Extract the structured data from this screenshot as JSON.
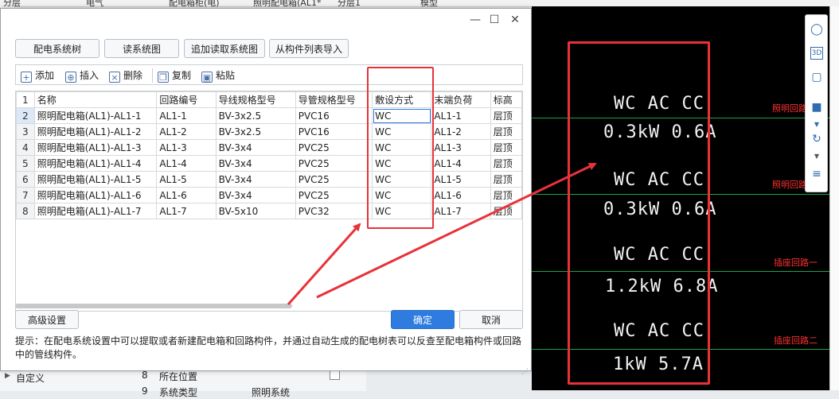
{
  "background": {
    "top_tabs": [
      "分层",
      "电气",
      "配电箱柜(电)",
      "照明配电箱(AL1*",
      "分层1",
      "模型"
    ],
    "left_bottom_label": "自定义",
    "bottom_rows": [
      {
        "num": "8",
        "label": "所在位置"
      },
      {
        "num": "9",
        "label": "系统类型",
        "value": "照明系统"
      }
    ]
  },
  "dialog": {
    "win_controls": {
      "minimize": "—",
      "maximize": "☐",
      "close": "✕"
    },
    "buttons_top": [
      "配电系统树",
      "读系统图",
      "追加读取系统图",
      "从构件列表导入"
    ],
    "toolbar": [
      {
        "label": "添加",
        "icon": "add-icon",
        "glyph": "+"
      },
      {
        "label": "插入",
        "icon": "insert-icon",
        "glyph": "⊕"
      },
      {
        "label": "删除",
        "icon": "delete-icon",
        "glyph": "×"
      },
      {
        "label": "复制",
        "icon": "copy-icon",
        "glyph": "❐"
      },
      {
        "label": "粘贴",
        "icon": "paste-icon",
        "glyph": "▣"
      }
    ],
    "table": {
      "header_row_num": "1",
      "headers": [
        "名称",
        "回路编号",
        "导线规格型号",
        "导管规格型号",
        "敷设方式",
        "末端负荷",
        "标高"
      ],
      "rows": [
        {
          "num": "2",
          "cells": [
            "照明配电箱(AL1)-AL1-1",
            "AL1-1",
            "BV-3x2.5",
            "PVC16",
            "WC",
            "AL1-1",
            "层顶"
          ]
        },
        {
          "num": "3",
          "cells": [
            "照明配电箱(AL1)-AL1-2",
            "AL1-2",
            "BV-3x2.5",
            "PVC16",
            "WC",
            "AL1-2",
            "层顶"
          ]
        },
        {
          "num": "4",
          "cells": [
            "照明配电箱(AL1)-AL1-3",
            "AL1-3",
            "BV-3x4",
            "PVC25",
            "WC",
            "AL1-3",
            "层顶"
          ]
        },
        {
          "num": "5",
          "cells": [
            "照明配电箱(AL1)-AL1-4",
            "AL1-4",
            "BV-3x4",
            "PVC25",
            "WC",
            "AL1-4",
            "层顶"
          ]
        },
        {
          "num": "6",
          "cells": [
            "照明配电箱(AL1)-AL1-5",
            "AL1-5",
            "BV-3x4",
            "PVC25",
            "WC",
            "AL1-5",
            "层顶"
          ]
        },
        {
          "num": "7",
          "cells": [
            "照明配电箱(AL1)-AL1-6",
            "AL1-6",
            "BV-3x4",
            "PVC25",
            "WC",
            "AL1-6",
            "层顶"
          ]
        },
        {
          "num": "8",
          "cells": [
            "照明配电箱(AL1)-AL1-7",
            "AL1-7",
            "BV-5x10",
            "PVC32",
            "WC",
            "AL1-7",
            "层顶"
          ]
        }
      ]
    },
    "advanced_button": "高级设置",
    "ok_button": "确定",
    "cancel_button": "取消",
    "tip": "提示：在配电系统设置中可以提取或者新建配电箱和回路构件，并通过自动生成的配电树表可以反查至配电箱构件或回路中的管线构件。"
  },
  "cad": {
    "groups": [
      {
        "line1": "WC AC CC",
        "line2": "0.3kW  0.6A",
        "side_label": "照明回路一"
      },
      {
        "line1": "WC AC CC",
        "line2": "0.3kW  0.6A",
        "side_label": "照明回路二"
      },
      {
        "line1": "WC AC CC",
        "line2": "1.2kW  6.8A",
        "side_label": "插座回路一"
      },
      {
        "line1": "WC AC CC",
        "line2": "1kW  5.7A",
        "side_label": "插座回路二"
      }
    ]
  },
  "right_toolbar": {
    "icons": [
      "sphere-icon",
      "3d-view-icon",
      "box-icon",
      "box-solid-icon",
      "rotate-icon",
      "list-icon"
    ],
    "glyphs": [
      "◯",
      "3D",
      "▢",
      "■",
      "↻",
      "≡"
    ]
  },
  "colors": {
    "accent": "#2e7ce0",
    "annotation_red": "#e8323a",
    "cad_line": "#1aa34a"
  }
}
